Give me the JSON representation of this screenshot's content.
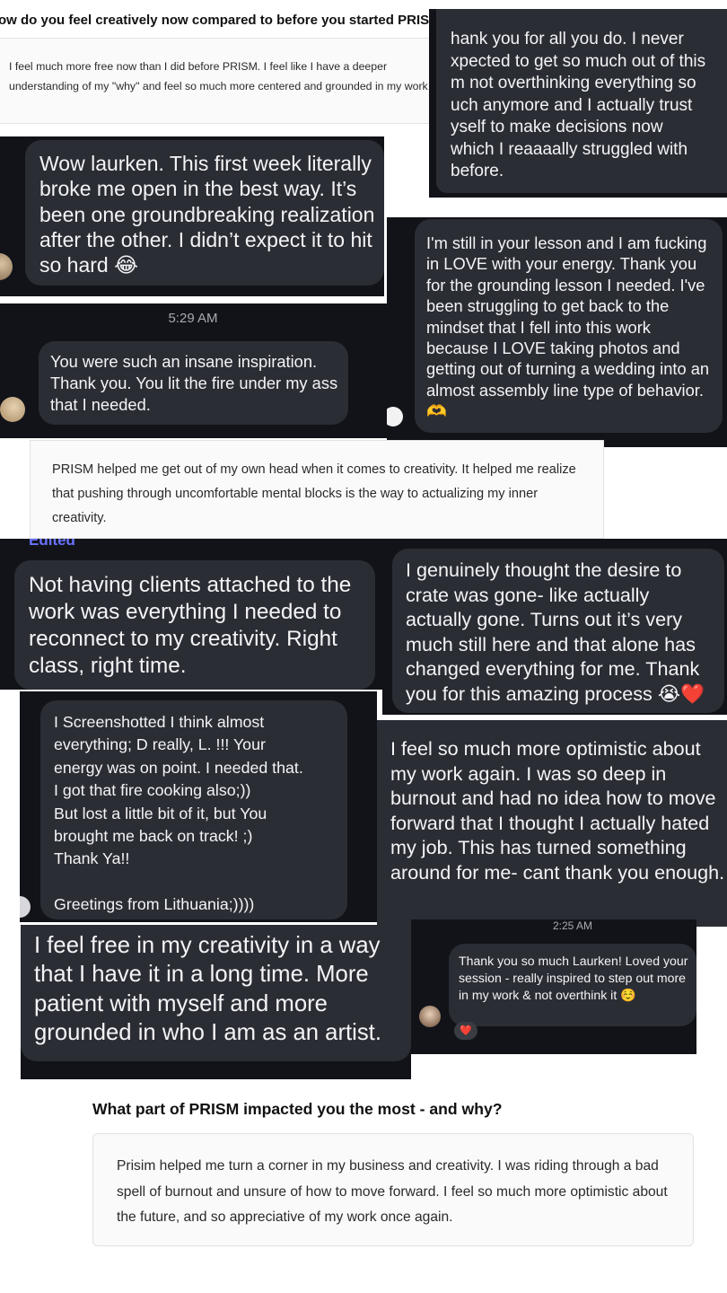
{
  "q1": {
    "question": "ow do you feel creatively now compared to before you started PRISM?",
    "answer": "I feel much more free now than I did before PRISM. I feel like I have a deeper understanding of my \"why\" and feel so much more centered and grounded in my work."
  },
  "msg_thankyou": "hank you for all you do. I never\nxpected to get so much out of this\nm not overthinking everything so\nuch anymore and I actually trust\nyself to make decisions now\nwhich I reaaaally struggled with\nbefore.",
  "msg_wow": "Wow laurken. This first week literally broke me open in the best way. It’s been one groundbreaking realization after the other. I didn’t expect it to hit so hard 😂",
  "msg_lesson": "I'm still in your lesson and I am fucking in LOVE with your energy. Thank you for the grounding lesson I needed. I've been struggling to get back to the mindset that I fell into this work because I LOVE taking photos and getting out of turning a wedding into an almost assembly line type of behavior. 🫶",
  "ts_529": "5:29 AM",
  "msg_inspiration": "You were such an insane inspiration. Thank you. You lit the fire under my ass that I needed.",
  "q2_answer": "PRISM helped me get out of my own head when it comes to creativity. It helped me realize that pushing through uncomfortable mental blocks is the way to actualizing my inner creativity.",
  "edited_label": "Edited",
  "msg_clients": "Not having clients attached to the work was everything I needed to reconnect to my creativity. Right class, right time.",
  "msg_desire": "I genuinely thought the desire to crate was gone- like actually actually gone. Turns out it’s very much still here and that alone has changed everything for me. Thank you for this amazing process 😭❤️",
  "msg_screenshotted": "I Screenshotted I think almost\neverything; D really, L. !!! Your\nenergy was on point. I needed that.\nI got that fire cooking also;))\nBut lost a little bit of it, but You\nbrought me back on track! ;)\nThank Ya!!\n\nGreetings from Lithuania;))))",
  "msg_optimistic": "I feel so much more optimistic about my work again. I was so deep in burnout and had no idea how to move forward that I thought I actually hated my job. This has turned something around for me- cant thank you enough.",
  "ts_225": "2:25 AM",
  "msg_free": "I feel free in my creativity in a way that I have it in a long time. More patient with myself and more grounded in who I am as an artist.",
  "msg_laurken": "Thank you so much Laurken! Loved your session - really inspired to step out more in my work & not overthink it ☺️",
  "reaction": "❤️",
  "q3": {
    "question": "What part of PRISM impacted you the most - and why?",
    "answer": "Prisim helped me turn a corner in my business and creativity. I was riding through a bad spell of burnout and unsure of how to move forward. I feel so much more optimistic about the future, and so appreciative of my work once again."
  }
}
